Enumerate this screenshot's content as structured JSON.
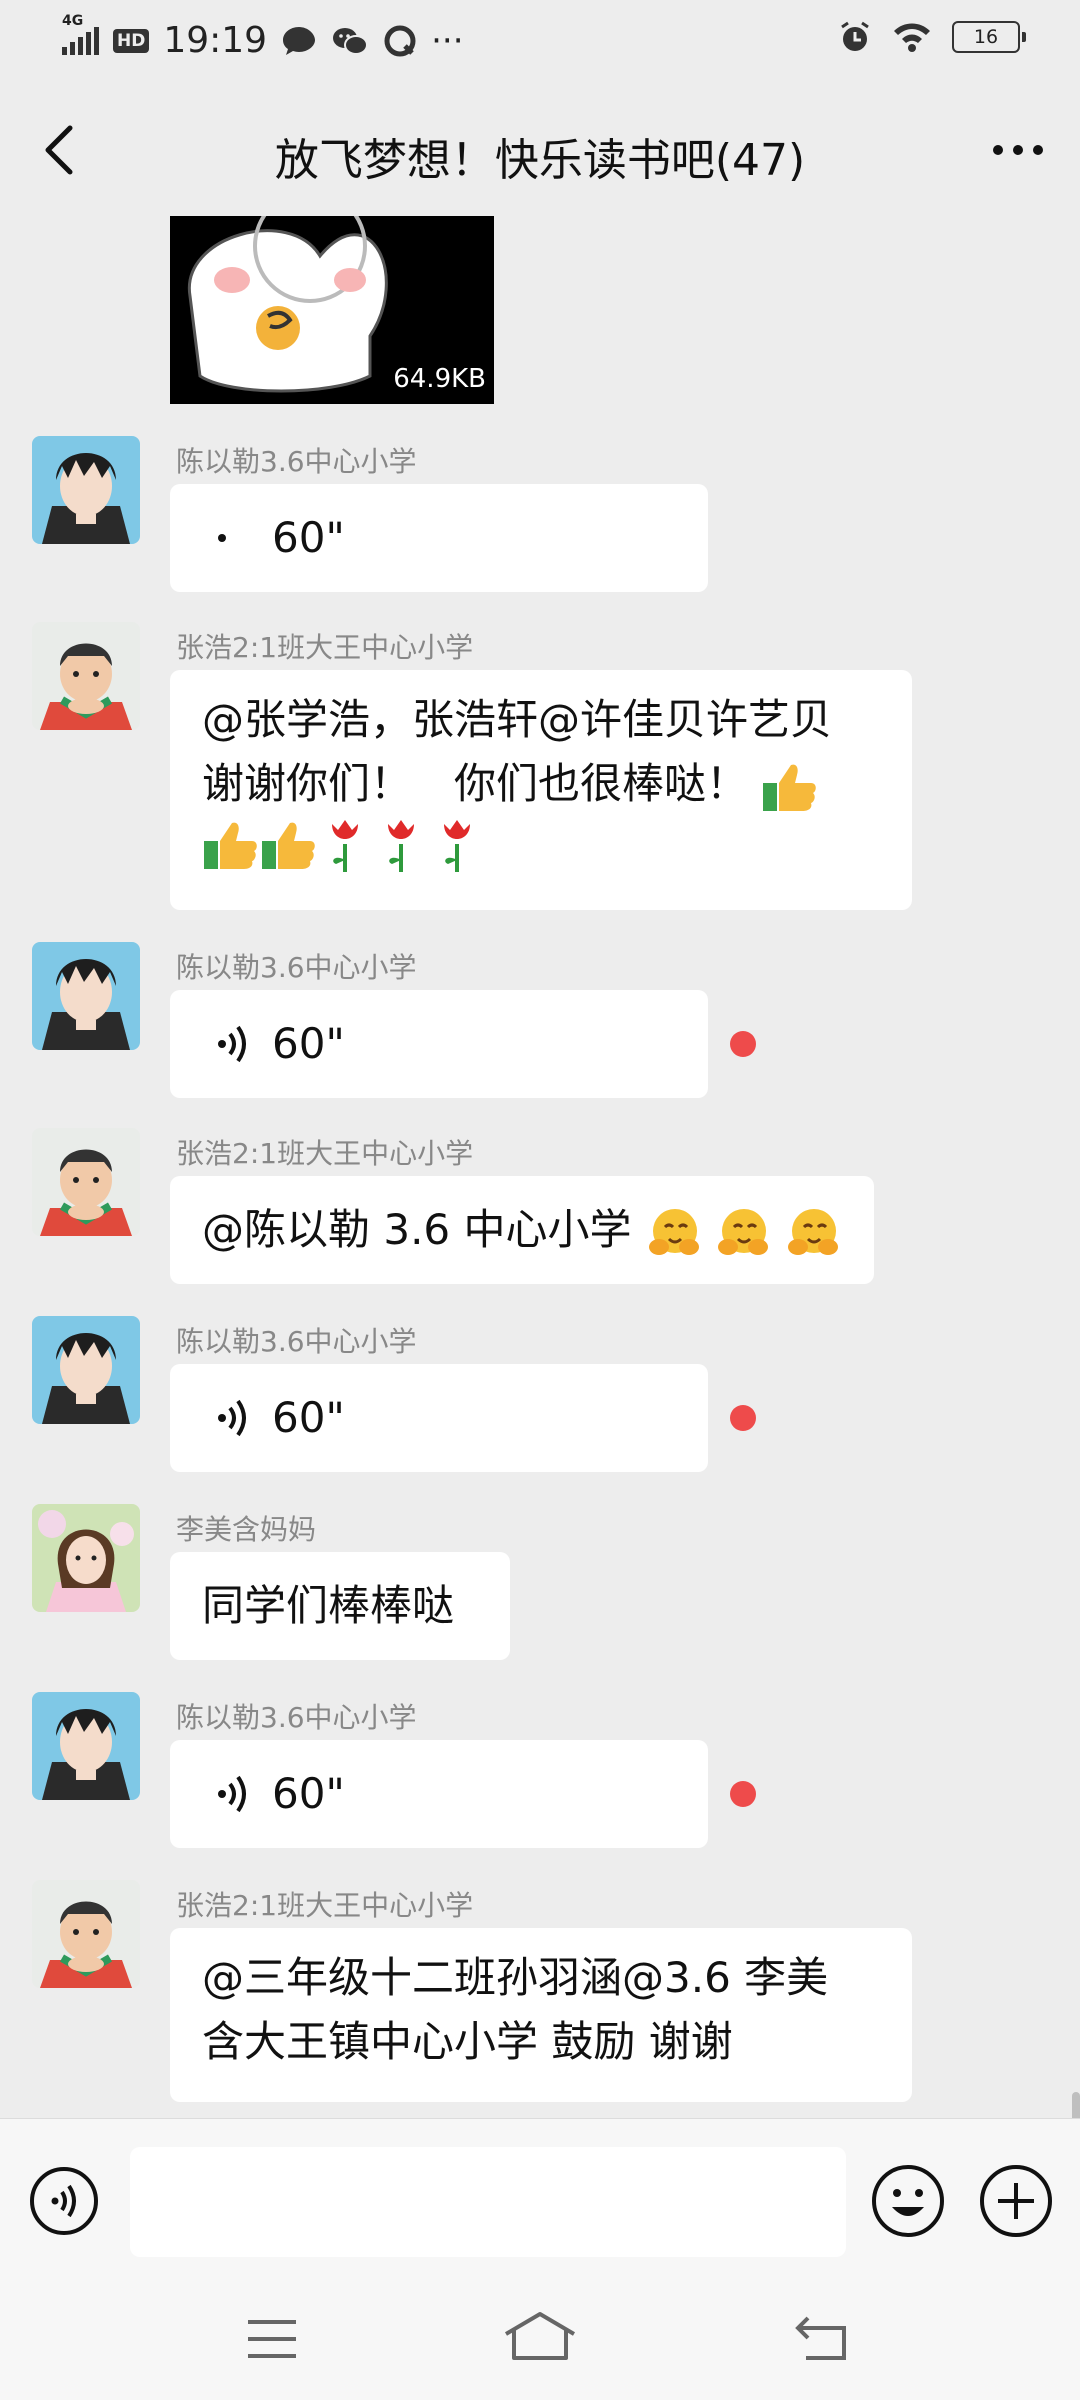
{
  "status_bar": {
    "network": "4G",
    "hd": "HD",
    "time": "19:19",
    "more": "···",
    "battery": "16"
  },
  "header": {
    "title": "放飞梦想！快乐读书吧(47)"
  },
  "image_message": {
    "size": "64.9KB"
  },
  "messages": [
    {
      "sender": "陈以勒3.6中心小学",
      "type": "voice",
      "duration": "60\"",
      "unread": false
    },
    {
      "sender": "张浩2:1班大王中心小学",
      "type": "text",
      "line1": "@张学浩，张浩轩@许佳贝许艺贝",
      "line2": "谢谢你们！　你们也很棒哒！"
    },
    {
      "sender": "陈以勒3.6中心小学",
      "type": "voice",
      "duration": "60\"",
      "unread": true
    },
    {
      "sender": "张浩2:1班大王中心小学",
      "type": "text",
      "text": "@陈以勒 3.6 中心小学 "
    },
    {
      "sender": "陈以勒3.6中心小学",
      "type": "voice",
      "duration": "60\"",
      "unread": true
    },
    {
      "sender": "李美含妈妈",
      "type": "text",
      "text": "同学们棒棒哒"
    },
    {
      "sender": "陈以勒3.6中心小学",
      "type": "voice",
      "duration": "60\"",
      "unread": true
    },
    {
      "sender": "张浩2:1班大王中心小学",
      "type": "text",
      "line1": "@三年级十二班孙羽涵@3.6 李美",
      "line2": "含大王镇中心小学  鼓励  谢谢"
    }
  ],
  "colors": {
    "background": "#ededed",
    "bubble": "#ffffff",
    "unread_dot": "#ee4b4b",
    "sender_name": "#888888"
  }
}
